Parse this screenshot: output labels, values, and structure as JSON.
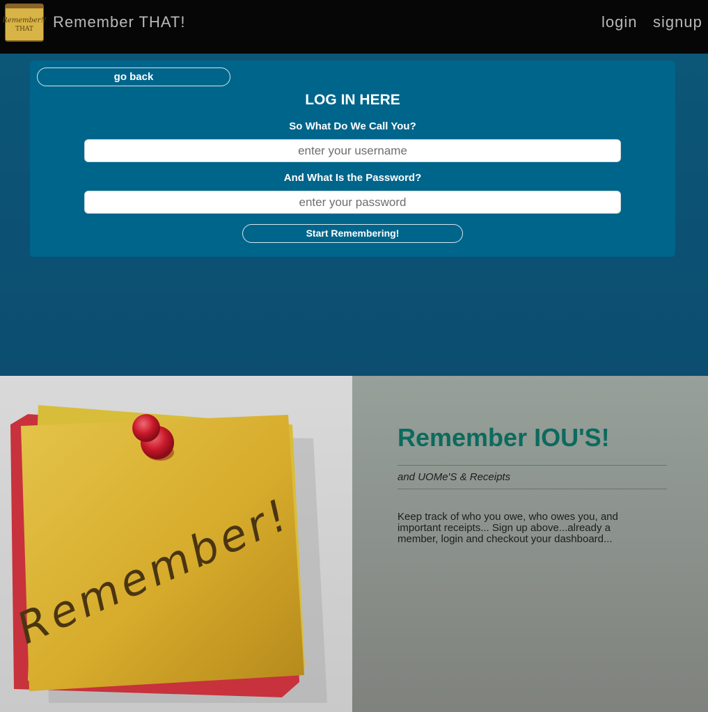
{
  "navbar": {
    "brand": "Remember THAT!",
    "logo_text_1": "Remember!!",
    "logo_text_2": "THAT",
    "login": "login",
    "signup": "signup"
  },
  "login_panel": {
    "go_back": "go back",
    "title": "LOG IN HERE",
    "username_label": "So What Do We Call You?",
    "username_placeholder": "enter your username",
    "username_value": "",
    "password_label": "And What Is the Password?",
    "password_placeholder": "enter your password",
    "password_value": "",
    "submit": "Start Remembering!"
  },
  "feature": {
    "image_text": "Remember!",
    "title": "Remember IOU'S!",
    "subtitle": "and UOMe'S & Receipts",
    "body": "Keep track of who you owe, who owes you, and important receipts... Sign up above...already a member, login and checkout your dashboard..."
  },
  "colors": {
    "navbar": "#060606",
    "hero": "#0c5678",
    "panel": "#00658b",
    "accent_title": "#0b6b5d"
  }
}
